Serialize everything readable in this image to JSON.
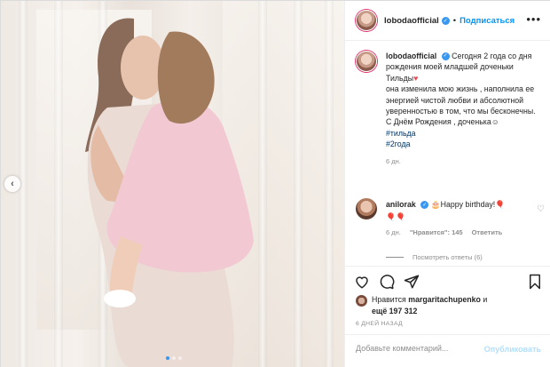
{
  "post": {
    "username": "lobodaofficial",
    "verified_icon": "verified-badge-icon",
    "follow_label": "Подписаться",
    "separator": "•",
    "more_icon": "more-options-icon",
    "caption_lines": [
      "Сегодня 2 года со дня рождения моей младшей доченьки Тильды",
      "она изменила мою жизнь , наполнила ее энергией чистой любви и абсолютной уверенностью в том, что мы бесконечны.",
      "С Днём Рождения , доченька"
    ],
    "heart_emoji": "♥",
    "smile_emoji": "☺",
    "hashtags": [
      "#тильда",
      "#2года"
    ],
    "caption_time": "6 дн.",
    "carousel": {
      "current": 1,
      "total": 3
    }
  },
  "comment": {
    "username": "anilorak",
    "text": "🎂Happy birthday!🎈",
    "text2": "🎈🎈",
    "time": "6 дн.",
    "likes_label": "\"Нравится\": 145",
    "reply_label": "Ответить",
    "view_replies": "Посмотреть ответы (6)"
  },
  "actions": {
    "like_icon": "heart-icon",
    "comment_icon": "comment-icon",
    "share_icon": "share-icon",
    "save_icon": "bookmark-icon"
  },
  "likes": {
    "prefix": "Нравится",
    "user": "margaritachupenko",
    "conj": "и",
    "others": "ещё 197 312"
  },
  "date_label": "6 ДНЕЙ НАЗАД",
  "add_comment": {
    "placeholder": "Добавьте комментарий...",
    "post_label": "Опубликовать"
  },
  "colors": {
    "accent": "#0095f6",
    "hashtag": "#00376b",
    "muted": "#8e8e8e",
    "post_disabled": "#b2dffc"
  }
}
